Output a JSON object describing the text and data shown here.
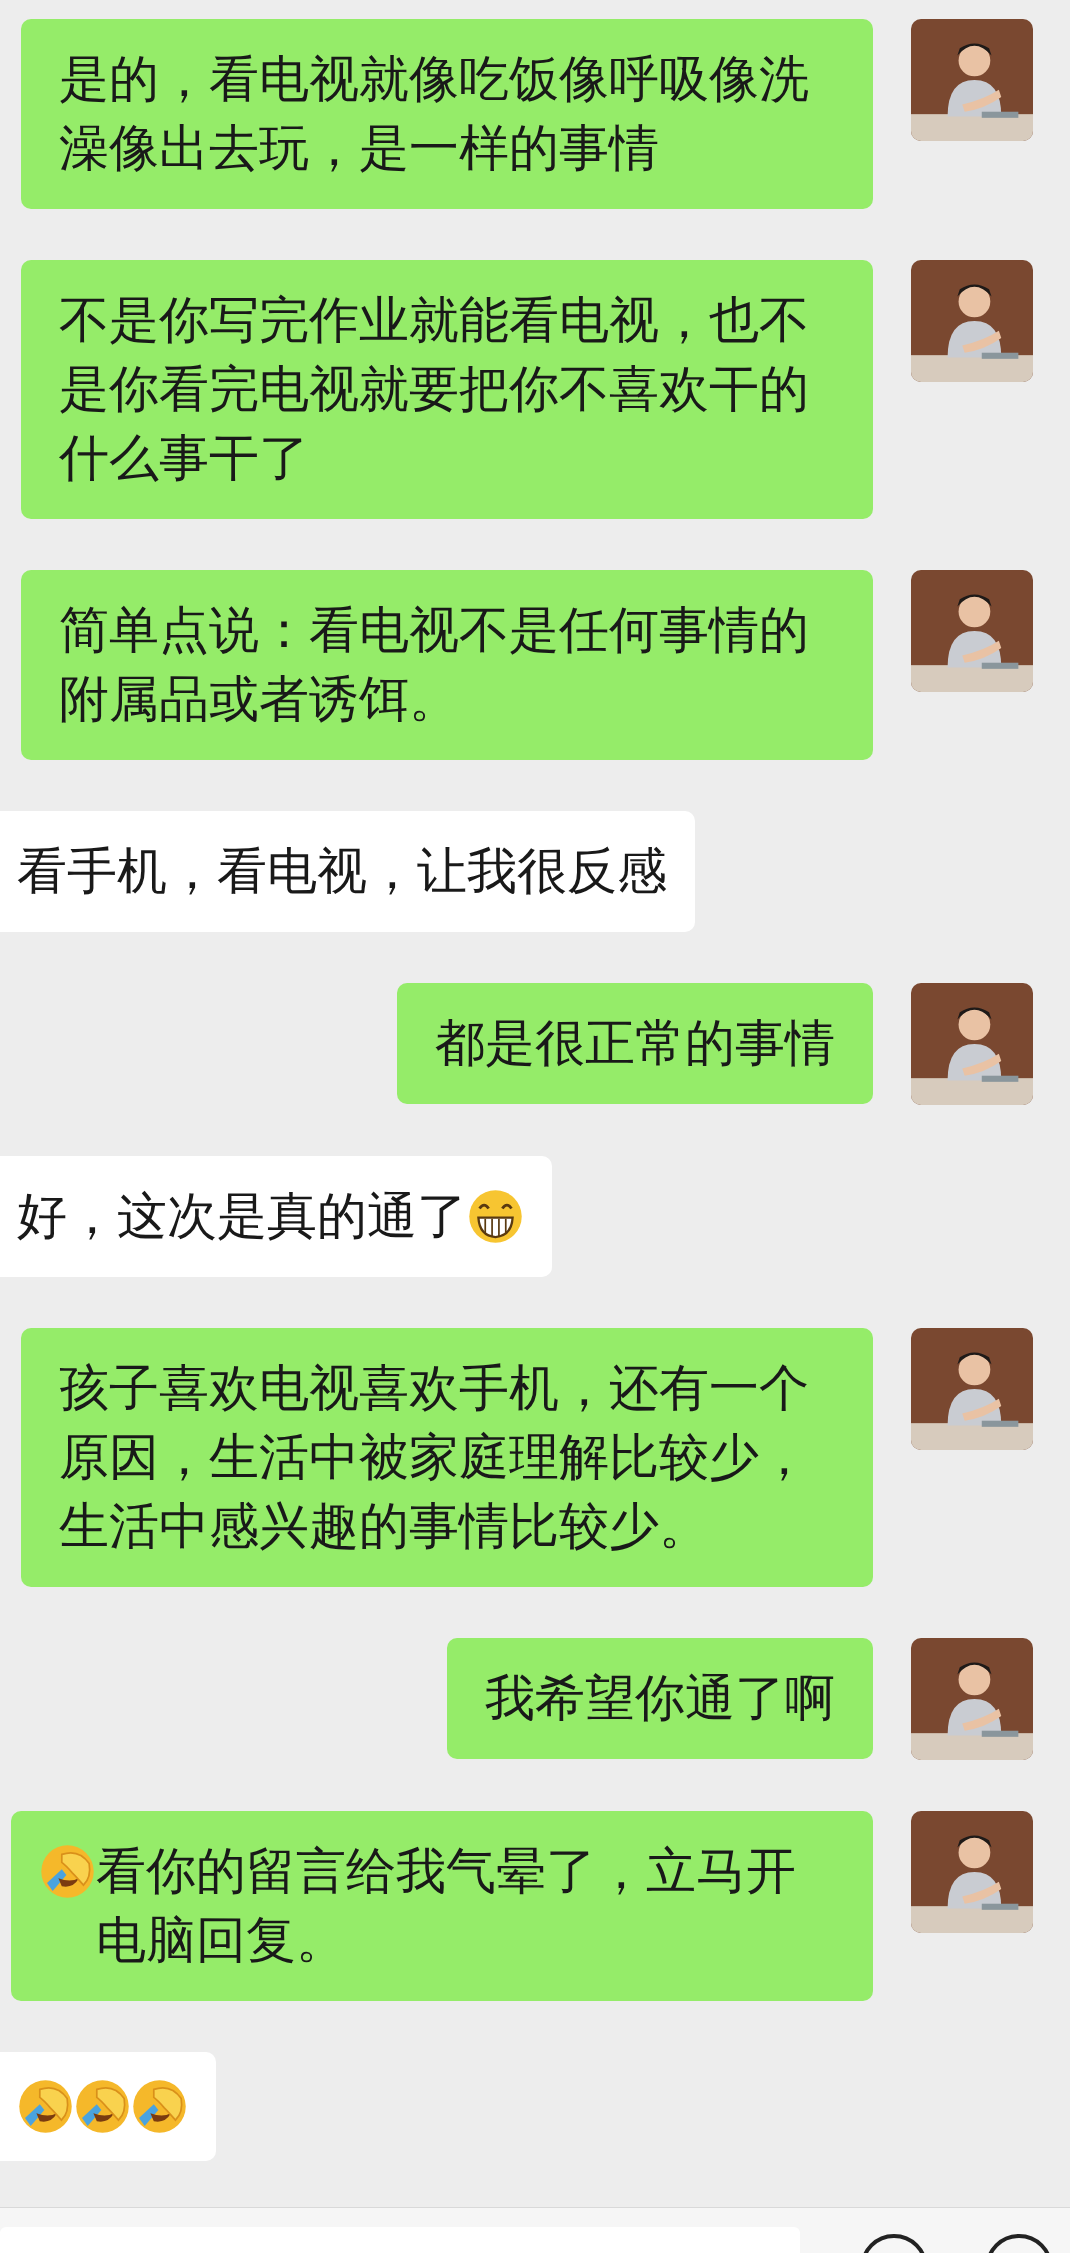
{
  "messages": [
    {
      "kind": "sent",
      "avatar": {
        "kind": "picture"
      },
      "parts": [
        {
          "kind": "text",
          "text": "是的，看电视就像吃饭像呼吸像洗澡像出去玩，是一样的事情"
        }
      ]
    },
    {
      "kind": "sent",
      "avatar": {
        "kind": "picture"
      },
      "parts": [
        {
          "kind": "text",
          "text": "不是你写完作业就能看电视，也不是你看完电视就要把你不喜欢干的什么事干了"
        }
      ]
    },
    {
      "kind": "sent",
      "avatar": {
        "kind": "picture"
      },
      "parts": [
        {
          "kind": "text",
          "text": "简单点说：看电视不是任何事情的附属品或者诱饵。"
        }
      ]
    },
    {
      "kind": "received",
      "parts": [
        {
          "kind": "text",
          "text": "看手机，看电视，让我很反感"
        }
      ]
    },
    {
      "kind": "sent",
      "avatar": {
        "kind": "picture"
      },
      "parts": [
        {
          "kind": "text",
          "text": "都是很正常的事情"
        }
      ]
    },
    {
      "kind": "received",
      "parts": [
        {
          "kind": "text",
          "text": "好，这次是真的通了"
        },
        {
          "kind": "grin-emoji"
        }
      ]
    },
    {
      "kind": "sent",
      "avatar": {
        "kind": "picture"
      },
      "parts": [
        {
          "kind": "text",
          "text": "孩子喜欢电视喜欢手机，还有一个原因，生活中被家庭理解比较少，生活中感兴趣的事情比较少。"
        }
      ]
    },
    {
      "kind": "sent",
      "avatar": {
        "kind": "picture"
      },
      "parts": [
        {
          "kind": "text",
          "text": "我希望你通了啊"
        }
      ]
    },
    {
      "kind": "sent",
      "avatar": {
        "kind": "picture"
      },
      "parts": [
        {
          "kind": "facepalm-emoji"
        },
        {
          "kind": "text",
          "text": "看你的留言给我气晕了，立马开电脑回复。"
        }
      ]
    },
    {
      "kind": "received",
      "parts": [
        {
          "kind": "facepalm-emoji"
        },
        {
          "kind": "facepalm-emoji"
        },
        {
          "kind": "facepalm-emoji"
        }
      ]
    }
  ]
}
